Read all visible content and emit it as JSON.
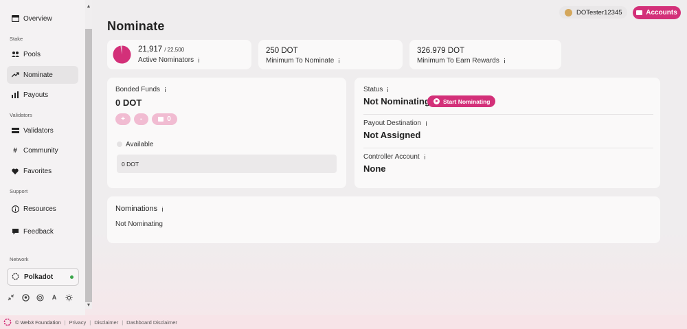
{
  "sidebar": {
    "overview": "Overview",
    "section_stake": "Stake",
    "pools": "Pools",
    "nominate": "Nominate",
    "payouts": "Payouts",
    "section_validators": "Validators",
    "validators": "Validators",
    "community": "Community",
    "favorites": "Favorites",
    "section_support": "Support",
    "resources": "Resources",
    "feedback": "Feedback",
    "section_network": "Network",
    "network_name": "Polkadot"
  },
  "header": {
    "title": "Nominate",
    "account_name": "DOTester12345",
    "accounts_label": "Accounts"
  },
  "stats": {
    "nominators_value": "21,917",
    "nominators_max": "/ 22,500",
    "nominators_fill": 0.974,
    "nominators_label": "Active Nominators",
    "min_nominate_value": "250 DOT",
    "min_nominate_label": "Minimum To Nominate",
    "min_rewards_value": "326.979 DOT",
    "min_rewards_label": "Minimum To Earn Rewards"
  },
  "bonded": {
    "label": "Bonded Funds",
    "value": "0 DOT",
    "plus": "+",
    "minus": "-",
    "unlock_count": "0",
    "available_label": "Available",
    "available_value": "0 DOT"
  },
  "status": {
    "status_label": "Status",
    "status_value": "Not Nominating",
    "start_button": "Start Nominating",
    "payout_label": "Payout Destination",
    "payout_value": "Not Assigned",
    "controller_label": "Controller Account",
    "controller_value": "None"
  },
  "nominations": {
    "title": "Nominations",
    "empty": "Not Nominating"
  },
  "footer": {
    "copyright": "© Web3 Foundation",
    "privacy": "Privacy",
    "disclaimer": "Disclaimer",
    "dashboard_disclaimer": "Dashboard Disclaimer"
  },
  "colors": {
    "accent": "#d33079",
    "accent_light": "#f1bcd2",
    "online": "#3aa54a"
  }
}
